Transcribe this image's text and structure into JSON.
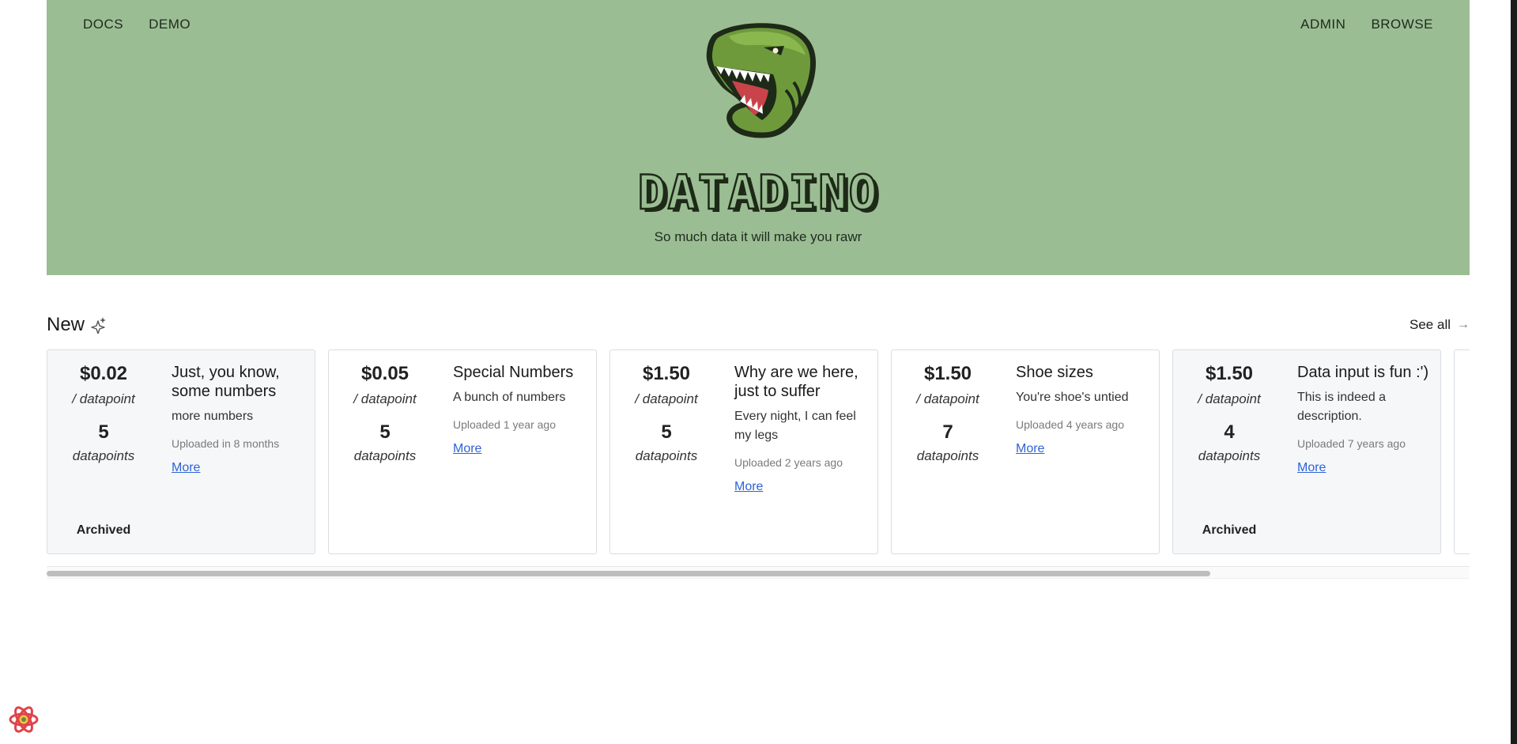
{
  "nav": {
    "left": [
      "DOCS",
      "DEMO"
    ],
    "right": [
      "ADMIN",
      "BROWSE"
    ]
  },
  "hero": {
    "brand": "DATADINO",
    "tagline": "So much data it will make you rawr"
  },
  "section": {
    "title": "New",
    "see_all": "See all"
  },
  "cards": [
    {
      "price": "$0.02",
      "unit": "/ datapoint",
      "count": "5",
      "count_label": "datapoints",
      "title": "Just, you know, some numbers",
      "description": "more numbers",
      "uploaded": "Uploaded in 8 months",
      "more": "More",
      "status": "Archived"
    },
    {
      "price": "$0.05",
      "unit": "/ datapoint",
      "count": "5",
      "count_label": "datapoints",
      "title": "Special Numbers",
      "description": "A bunch of numbers",
      "uploaded": "Uploaded 1 year ago",
      "more": "More",
      "status": ""
    },
    {
      "price": "$1.50",
      "unit": "/ datapoint",
      "count": "5",
      "count_label": "datapoints",
      "title": "Why are we here, just to suffer",
      "description": "Every night, I can feel my legs",
      "uploaded": "Uploaded 2 years ago",
      "more": "More",
      "status": ""
    },
    {
      "price": "$1.50",
      "unit": "/ datapoint",
      "count": "7",
      "count_label": "datapoints",
      "title": "Shoe sizes",
      "description": "You're shoe's untied",
      "uploaded": "Uploaded 4 years ago",
      "more": "More",
      "status": ""
    },
    {
      "price": "$1.50",
      "unit": "/ datapoint",
      "count": "4",
      "count_label": "datapoints",
      "title": "Data input is fun :')",
      "description": "This is indeed a description.",
      "uploaded": "Uploaded 7 years ago",
      "more": "More",
      "status": "Archived"
    }
  ],
  "colors": {
    "hero_bg": "#9bbd93",
    "link": "#2f63d6",
    "archived_bg": "#f6f7f9"
  },
  "icons": {
    "logo": "t-rex-logo",
    "sparkle": "sparkles-icon",
    "arrow": "arrow-right-icon",
    "devtools": "react-query-devtools-icon"
  }
}
